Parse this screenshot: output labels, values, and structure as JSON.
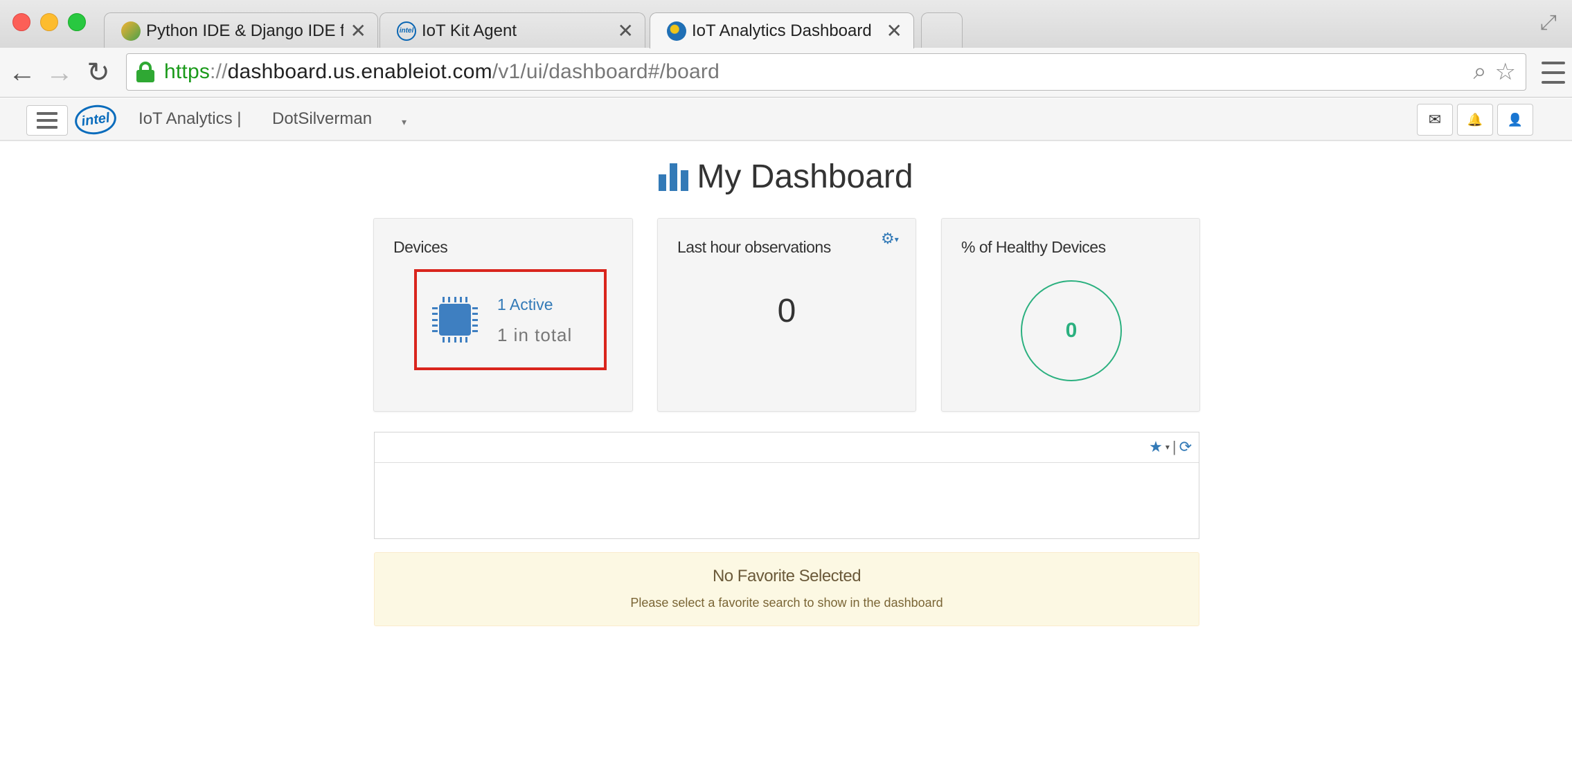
{
  "browser": {
    "tabs": [
      {
        "title": "Python IDE & Django IDE fo",
        "active": false,
        "favicon": "pycharm-icon"
      },
      {
        "title": "IoT Kit Agent",
        "active": false,
        "favicon": "intel-icon"
      },
      {
        "title": "IoT Analytics Dashboard",
        "active": true,
        "favicon": "dashboard-globe-icon"
      }
    ],
    "tab_close": "✕",
    "url": {
      "scheme": "https",
      "sep": "://",
      "host": "dashboard.us.enableiot.com",
      "path": "/v1/ui/dashboard#/board"
    }
  },
  "appbar": {
    "logo_text": "intel",
    "brand": "IoT Analytics |",
    "account": "DotSilverman",
    "account_caret": "▾",
    "buttons": {
      "messages": "✉",
      "alerts": "🔔",
      "user": "👤"
    }
  },
  "page": {
    "title": "My Dashboard"
  },
  "cards": {
    "devices": {
      "title": "Devices",
      "active": "1 Active",
      "total": "1 in total"
    },
    "observations": {
      "title": "Last hour observations",
      "value": "0"
    },
    "healthy": {
      "title": "% of Healthy Devices",
      "value": "0"
    }
  },
  "favorites": {
    "notice_title": "No Favorite Selected",
    "notice_text": "Please select a favorite search to show in the dashboard"
  },
  "colors": {
    "accent": "#337ab7",
    "highlight_border": "#d9251d",
    "healthy": "#2bb07f",
    "warning_bg": "#fcf8e3",
    "url_scheme": "#1a9a1a"
  }
}
